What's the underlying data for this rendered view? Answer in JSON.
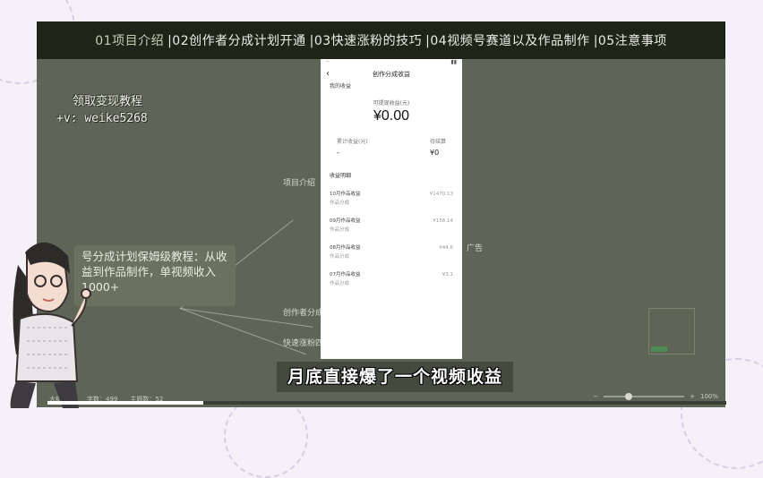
{
  "nav": {
    "items": [
      "01项目介绍",
      "|02创作者分成计划开通",
      "|03快速涨粉的技巧",
      "|04视频号赛道以及作品制作",
      "|05注意事项"
    ]
  },
  "watermark": {
    "line1": "领取变现教程",
    "line2": "+v: weike5268"
  },
  "mindmap": {
    "node_intro": "项目介绍",
    "node_creator": "创作者分成",
    "node_grow": "快速涨粉四",
    "node_ad": "广告"
  },
  "phone": {
    "title": "创作分成收益",
    "back": "‹",
    "section": "我的收益",
    "balance_label": "可提现收益(元)",
    "balance": "¥0.00",
    "stat_left_label": "累计收益(元)",
    "stat_left_value": "-",
    "stat_right_label": "待结算",
    "stat_right_value": "¥0",
    "list_title": "收益明细",
    "rows": [
      {
        "name": "10月作品收益",
        "sub": "作品分成",
        "amount": "¥1470.13"
      },
      {
        "name": "09月作品收益",
        "sub": "作品分成",
        "amount": "¥156.14"
      },
      {
        "name": "08月作品收益",
        "sub": "作品分成",
        "amount": "¥44.6"
      },
      {
        "name": "07月作品收益",
        "sub": "作品分成",
        "amount": "¥3.1"
      }
    ]
  },
  "callout": {
    "text": "号分成计划保姆级教程：从收益到作品制作，单视频收入1000+"
  },
  "subtitle": {
    "text": "月底直接爆了一个视频收益"
  },
  "bottombar": {
    "mode": "大纲模式",
    "words_label": "字数：499",
    "nodes_label": "主题数：52",
    "zoom": "100%",
    "minus": "−",
    "plus": "+"
  },
  "progress": {
    "fraction": 0.23
  },
  "colors": {
    "nav_bg": "#1e2418",
    "frame_bg": "#5e6456",
    "progress_fill": "#ffffff"
  }
}
